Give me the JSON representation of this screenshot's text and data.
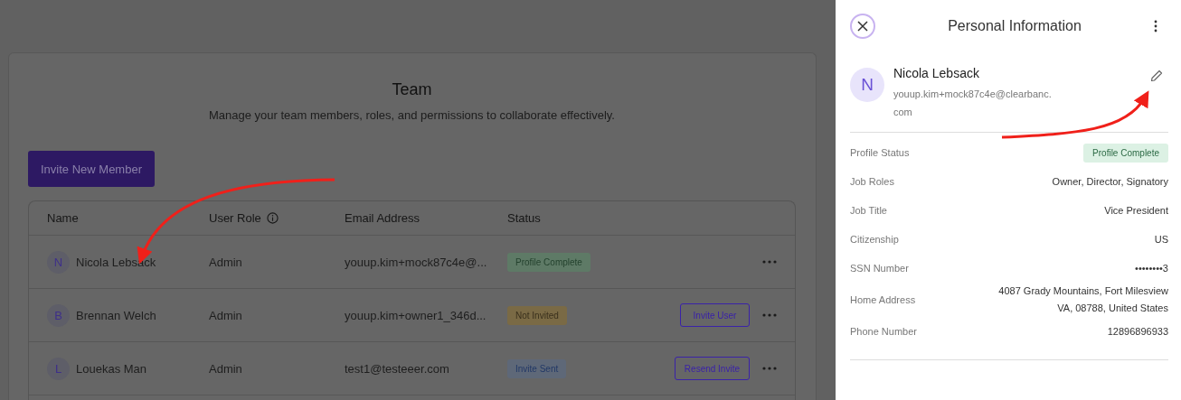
{
  "team": {
    "title": "Team",
    "subtitle": "Manage your team members, roles, and permissions to collaborate effectively.",
    "invite_button": "Invite New Member",
    "table": {
      "columns": [
        {
          "label": "Name",
          "info": false
        },
        {
          "label": "User Role",
          "info": true
        },
        {
          "label": "Email Address",
          "info": false
        },
        {
          "label": "Status",
          "info": false
        }
      ],
      "rows": [
        {
          "initial": "N",
          "name": "Nicola Lebsack",
          "role": "Admin",
          "email": "youup.kim+mock87c4e@...",
          "status": {
            "text": "Profile Complete",
            "kind": "complete"
          }
        },
        {
          "initial": "B",
          "name": "Brennan Welch",
          "role": "Admin",
          "email": "youup.kim+owner1_346d...",
          "status": {
            "text": "Not Invited",
            "kind": "pending"
          },
          "action": "Invite User"
        },
        {
          "initial": "L",
          "name": "Louekas Man",
          "role": "Admin",
          "email": "test1@testeeer.com",
          "status": {
            "text": "Invite Sent",
            "kind": "sent"
          },
          "action": "Resend Invite"
        }
      ]
    }
  },
  "panel": {
    "title": "Personal Information",
    "profile": {
      "initial": "N",
      "name": "Nicola Lebsack",
      "email": "youup.kim+mock87c4e@clearbanc.com"
    },
    "fields": [
      {
        "label": "Profile Status",
        "value": "Profile Complete",
        "kind": "badge"
      },
      {
        "label": "Job Roles",
        "value": "Owner, Director, Signatory",
        "kind": "text"
      },
      {
        "label": "Job Title",
        "value": "Vice President",
        "kind": "text"
      },
      {
        "label": "Citizenship",
        "value": "US",
        "kind": "text"
      },
      {
        "label": "SSN Number",
        "value": "••••••••3",
        "kind": "text"
      },
      {
        "label": "Home Address",
        "value": "4087 Grady Mountains, Fort Milesview\nVA, 08788, United States",
        "kind": "text"
      },
      {
        "label": "Phone Number",
        "value": "12896896933",
        "kind": "text"
      }
    ]
  }
}
